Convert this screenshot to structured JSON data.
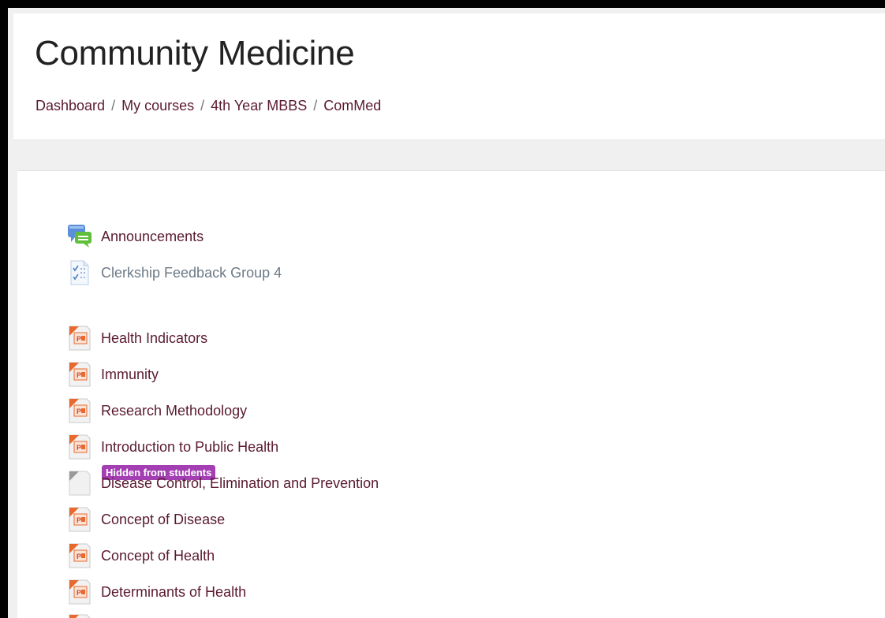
{
  "page": {
    "title": "Community Medicine"
  },
  "breadcrumb": [
    {
      "label": "Dashboard"
    },
    {
      "label": "My courses"
    },
    {
      "label": "4th Year MBBS"
    },
    {
      "label": "ComMed"
    }
  ],
  "breadcrumb_separator": "/",
  "activities": [
    {
      "label": "Announcements",
      "icon": "forum-icon"
    },
    {
      "label": "Clerkship Feedback Group 4",
      "icon": "feedback-icon",
      "badge": "Hidden from students"
    },
    {
      "label": "Health Indicators",
      "icon": "powerpoint-icon"
    },
    {
      "label": "Immunity",
      "icon": "powerpoint-icon"
    },
    {
      "label": "Research Methodology",
      "icon": "powerpoint-icon"
    },
    {
      "label": "Introduction to Public Health",
      "icon": "powerpoint-icon"
    },
    {
      "label": "Disease Control, Elimination and Prevention",
      "icon": "file-icon"
    },
    {
      "label": "Concept of Disease",
      "icon": "powerpoint-icon"
    },
    {
      "label": "Concept of Health",
      "icon": "powerpoint-icon"
    },
    {
      "label": "Determinants of Health",
      "icon": "powerpoint-icon"
    }
  ],
  "colors": {
    "link": "#5a1a2e",
    "badge": "#a33fb2",
    "hidden_text": "#6c7a86"
  }
}
